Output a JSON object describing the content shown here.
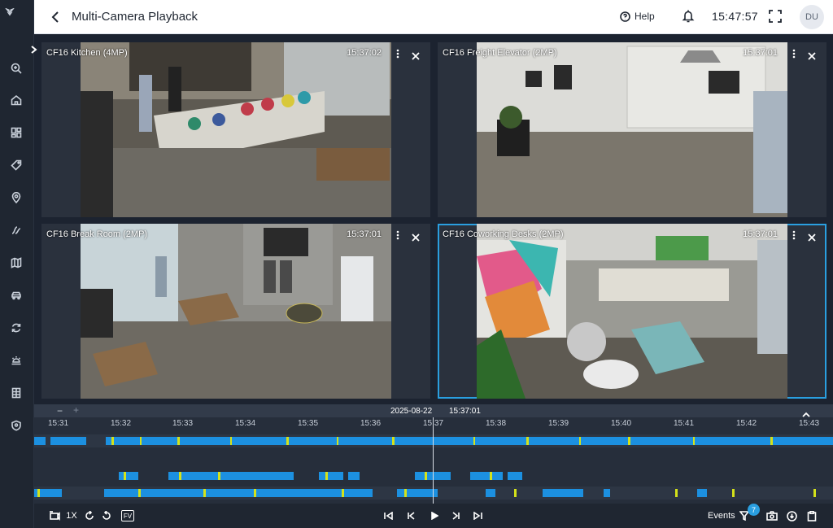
{
  "header": {
    "title": "Multi-Camera Playback",
    "help_label": "Help",
    "clock": "15:47:57",
    "avatar_initials": "DU"
  },
  "cameras": [
    {
      "name": "CF16 Kitchen (4MP)",
      "timestamp": "15:37:02",
      "selected": false
    },
    {
      "name": "CF16 Freight Elevator (2MP)",
      "timestamp": "15:37:01",
      "selected": false
    },
    {
      "name": "CF16 Break Room (2MP)",
      "timestamp": "15:37:01",
      "selected": false
    },
    {
      "name": "CF16 Coworking Desks (2MP)",
      "timestamp": "15:37:01",
      "selected": true
    }
  ],
  "timeline": {
    "date": "2025-08-22",
    "time": "15:37:01",
    "zoom_out": "−",
    "zoom_in": "+",
    "ticks": [
      "15:31",
      "15:32",
      "15:33",
      "15:34",
      "15:35",
      "15:36",
      "15:37",
      "15:38",
      "15:39",
      "15:40",
      "15:41",
      "15:42",
      "15:43"
    ]
  },
  "controls": {
    "speed": "1X",
    "fv_label": "FV",
    "events_label": "Events",
    "events_count": "7"
  },
  "colors": {
    "accent": "#2a9fe0",
    "motion": "#1c90e0",
    "highlight": "#d4e21a"
  },
  "icons": [
    "logo-icon",
    "search-icon",
    "home-icon",
    "dashboard-icon",
    "tag-icon",
    "location-icon",
    "access-icon",
    "map-icon",
    "vehicle-icon",
    "sync-icon",
    "alarm-icon",
    "building-icon",
    "shield-icon"
  ]
}
